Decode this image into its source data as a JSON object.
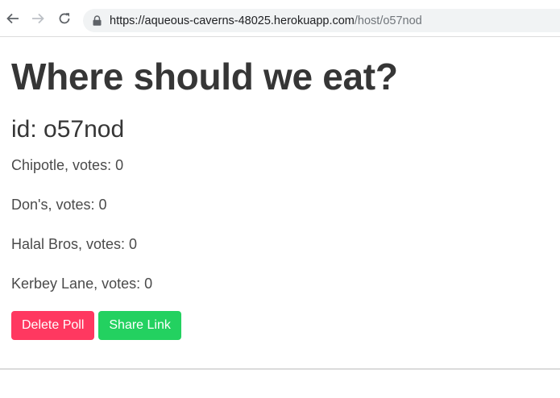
{
  "browser": {
    "url_host": "https://aqueous-caverns-48025.herokuapp.com",
    "url_path": "/host/o57nod",
    "icons": [
      "back-arrow-icon",
      "forward-arrow-icon",
      "reload-icon",
      "lock-icon"
    ]
  },
  "page": {
    "title": "Where should we eat?",
    "id_label": "id: o57nod",
    "options": [
      "Chipotle, votes: 0",
      "Don's, votes: 0",
      "Halal Bros, votes: 0",
      "Kerbey Lane, votes: 0"
    ],
    "delete_label": "Delete Poll",
    "share_label": "Share Link"
  },
  "colors": {
    "danger": "#ff3860",
    "success": "#23d160",
    "text": "#363636"
  }
}
